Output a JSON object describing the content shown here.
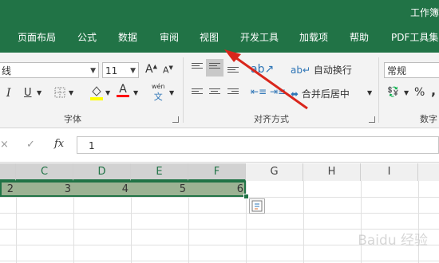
{
  "window": {
    "title": "工作簿"
  },
  "tabs": [
    "页面布局",
    "公式",
    "数据",
    "审阅",
    "视图",
    "开发工具",
    "加载项",
    "帮助",
    "PDF工具集"
  ],
  "font_group": {
    "label": "字体",
    "font_name_partial": "线",
    "font_size": "11",
    "grow_font_label": "A",
    "shrink_font_label": "A",
    "italic_label": "I",
    "underline_label": "U",
    "fill_color": "#ffff00",
    "font_color": "#ff0000",
    "font_color_label": "A",
    "phonetic_label": "wén"
  },
  "align_group": {
    "label": "对齐方式",
    "wrap_text": "自动换行",
    "merge_center": "合并后居中"
  },
  "number_group": {
    "label_partial": "数字",
    "format": "常规",
    "percent": "%",
    "comma": ","
  },
  "formula_bar": {
    "cancel": "×",
    "enter": "✓",
    "fx": "fx",
    "value": "1"
  },
  "columns": [
    "C",
    "D",
    "E",
    "F",
    "G",
    "H",
    "I"
  ],
  "row1_values": [
    "2",
    "3",
    "4",
    "5",
    "6"
  ],
  "accent": "#217346",
  "selection_fill": "#9cb293",
  "watermark": "Baidu 经验"
}
